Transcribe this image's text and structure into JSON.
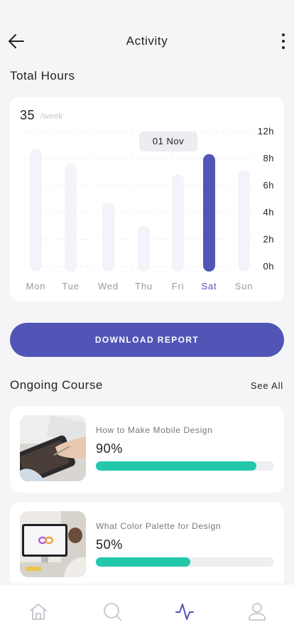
{
  "header": {
    "title": "Activity"
  },
  "total_hours": {
    "section_title": "Total Hours",
    "weekly_total": "35",
    "weekly_unit": "/week",
    "tooltip": "01 Nov"
  },
  "chart_data": {
    "type": "bar",
    "categories": [
      "Mon",
      "Tue",
      "Wed",
      "Thu",
      "Fri",
      "Sat",
      "Sun"
    ],
    "values": [
      9.1,
      8.0,
      5.1,
      3.4,
      7.2,
      8.7,
      7.5
    ],
    "selected": "Sat",
    "y_ticks": [
      "0h",
      "2h",
      "4h",
      "6h",
      "8h",
      "12h"
    ],
    "ylim": [
      0,
      10
    ],
    "colors": {
      "bar": "#f3f3f9",
      "selected_bar": "#5255b6",
      "label": "#999999",
      "selected_label": "#5255b6"
    },
    "grid": true
  },
  "download": {
    "label": "DOWNLOAD REPORT"
  },
  "ongoing": {
    "section_title": "Ongoing Course",
    "see_all": "See All",
    "courses": [
      {
        "title": "How to Make Mobile Design",
        "percent_label": "90%",
        "progress": 0.9
      },
      {
        "title": "What Color Palette for Design",
        "percent_label": "50%",
        "progress": 0.53
      }
    ]
  },
  "nav": {
    "items": [
      "home-icon",
      "search-icon",
      "activity-icon",
      "profile-icon"
    ],
    "active": "activity-icon",
    "colors": {
      "active": "#5255b6",
      "inactive": "#c5c5cc"
    }
  }
}
